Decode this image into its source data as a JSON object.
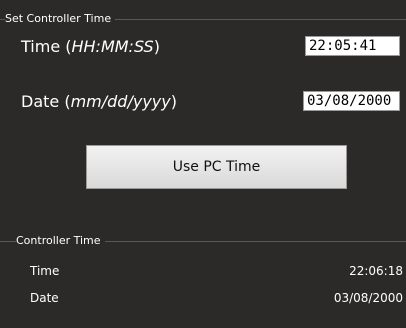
{
  "set_time": {
    "group_title": "Set Controller Time",
    "time_label": "Time",
    "time_hint": "HH:MM:SS",
    "time_value": "22:05:41",
    "date_label": "Date",
    "date_hint": "mm/dd/yyyy",
    "date_value": "03/08/2000",
    "use_pc_time_label": "Use PC Time"
  },
  "controller_time": {
    "group_title": "Controller Time",
    "time_label": "Time",
    "time_value": "22:06:18",
    "date_label": "Date",
    "date_value": "03/08/2000"
  }
}
